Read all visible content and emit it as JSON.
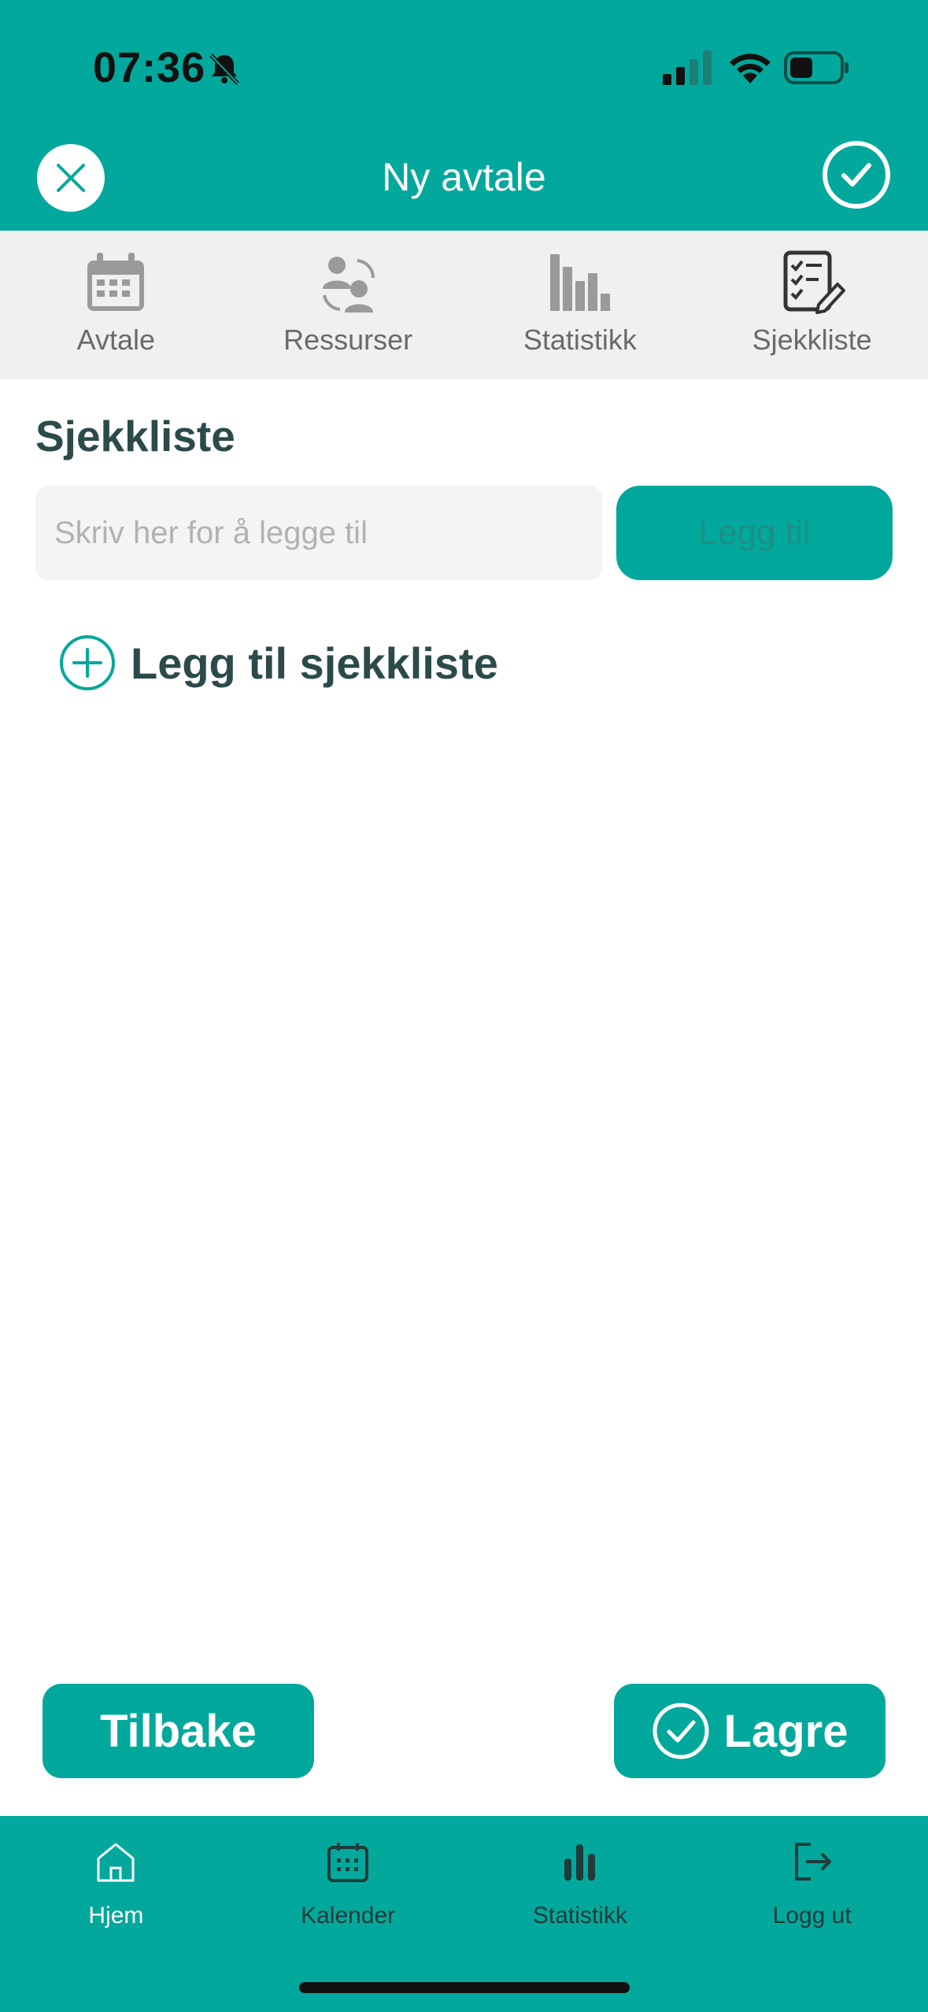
{
  "status": {
    "time": "07:36"
  },
  "header": {
    "title": "Ny avtale"
  },
  "tabs": [
    {
      "label": "Avtale",
      "icon": "calendar-icon"
    },
    {
      "label": "Ressurser",
      "icon": "resources-icon"
    },
    {
      "label": "Statistikk",
      "icon": "bar-chart-icon"
    },
    {
      "label": "Sjekkliste",
      "icon": "checklist-icon"
    }
  ],
  "content": {
    "section_title": "Sjekkliste",
    "input_placeholder": "Skriv her for å legge til",
    "add_button": "Legg til",
    "add_checklist": "Legg til sjekkliste"
  },
  "actions": {
    "back": "Tilbake",
    "save": "Lagre"
  },
  "nav": [
    {
      "label": "Hjem",
      "icon": "home-icon"
    },
    {
      "label": "Kalender",
      "icon": "calendar-icon"
    },
    {
      "label": "Statistikk",
      "icon": "bar-chart-icon"
    },
    {
      "label": "Logg ut",
      "icon": "logout-icon"
    }
  ],
  "colors": {
    "accent": "#03a89c",
    "dark_text": "#2c4a4a"
  }
}
